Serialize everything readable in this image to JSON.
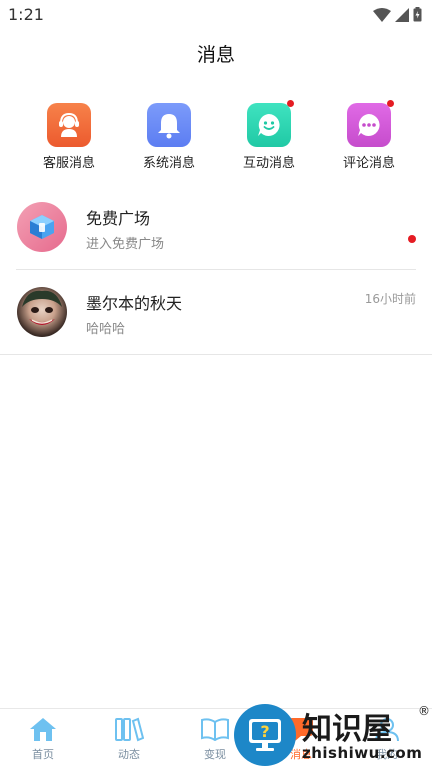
{
  "status_bar": {
    "time": "1:21"
  },
  "header": {
    "title": "消息"
  },
  "categories": [
    {
      "label": "客服消息",
      "icon": "customer-service-icon",
      "color": "#f0683a",
      "badge": false
    },
    {
      "label": "系统消息",
      "icon": "bell-icon",
      "color": "#6b8cf7",
      "badge": false
    },
    {
      "label": "互动消息",
      "icon": "smile-chat-icon",
      "color": "#2fd7b4",
      "badge": true
    },
    {
      "label": "评论消息",
      "icon": "comment-dots-icon",
      "color": "#d45ad8",
      "badge": true
    }
  ],
  "conversations": [
    {
      "title": "免费广场",
      "subtitle": "进入免费广场",
      "time": "",
      "unread": true
    },
    {
      "title": "墨尔本的秋天",
      "subtitle": "哈哈哈",
      "time": "16小时前",
      "unread": false
    }
  ],
  "bottom_nav": [
    {
      "label": "首页",
      "icon": "home-icon",
      "active": false
    },
    {
      "label": "动态",
      "icon": "books-icon",
      "active": false
    },
    {
      "label": "变现",
      "icon": "open-book-icon",
      "active": false
    },
    {
      "label": "消息",
      "icon": "message-icon",
      "active": true
    },
    {
      "label": "我的",
      "icon": "profile-icon",
      "active": false
    }
  ],
  "watermark": {
    "text": "知识屋",
    "url": "zhishiwu.com",
    "registered": "®"
  },
  "colors": {
    "accent": "#ff6a2a",
    "unread_dot": "#e51c23",
    "nav_inactive": "#7a8ea0"
  }
}
